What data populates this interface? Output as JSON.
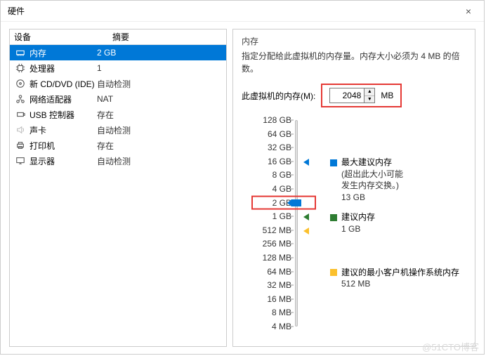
{
  "window": {
    "title": "硬件",
    "close": "×"
  },
  "hw_table": {
    "headers": {
      "device": "设备",
      "summary": "摘要"
    },
    "rows": [
      {
        "icon": "memory-icon",
        "device": "内存",
        "summary": "2 GB",
        "selected": true
      },
      {
        "icon": "cpu-icon",
        "device": "处理器",
        "summary": "1",
        "selected": false
      },
      {
        "icon": "cd-icon",
        "device": "新 CD/DVD (IDE)",
        "summary": "自动检测",
        "selected": false
      },
      {
        "icon": "network-icon",
        "device": "网络适配器",
        "summary": "NAT",
        "selected": false
      },
      {
        "icon": "usb-icon",
        "device": "USB 控制器",
        "summary": "存在",
        "selected": false
      },
      {
        "icon": "sound-icon",
        "device": "声卡",
        "summary": "自动检测",
        "selected": false
      },
      {
        "icon": "printer-icon",
        "device": "打印机",
        "summary": "存在",
        "selected": false
      },
      {
        "icon": "display-icon",
        "device": "显示器",
        "summary": "自动检测",
        "selected": false
      }
    ]
  },
  "memory": {
    "section_title": "内存",
    "desc": "指定分配给此虚拟机的内存量。内存大小必须为 4 MB 的倍数。",
    "input_label": "此虚拟机的内存(M):",
    "value": "2048",
    "unit": "MB",
    "ticks": [
      "128 GB",
      "64 GB",
      "32 GB",
      "16 GB",
      "8 GB",
      "4 GB",
      "2 GB",
      "1 GB",
      "512 MB",
      "256 MB",
      "128 MB",
      "64 MB",
      "32 MB",
      "16 MB",
      "8 MB",
      "4 MB"
    ],
    "current_index": 6,
    "markers": {
      "blue": {
        "index": 3,
        "label": "最大建议内存",
        "note1": "(超出此大小可能",
        "note2": "发生内存交换。)",
        "value": "13 GB"
      },
      "green": {
        "index": 7,
        "label": "建议内存",
        "value": "1 GB"
      },
      "yellow": {
        "index": 8,
        "label": "建议的最小客户机操作系统内存",
        "value": "512 MB"
      }
    }
  },
  "watermark": "@51CTO博客"
}
